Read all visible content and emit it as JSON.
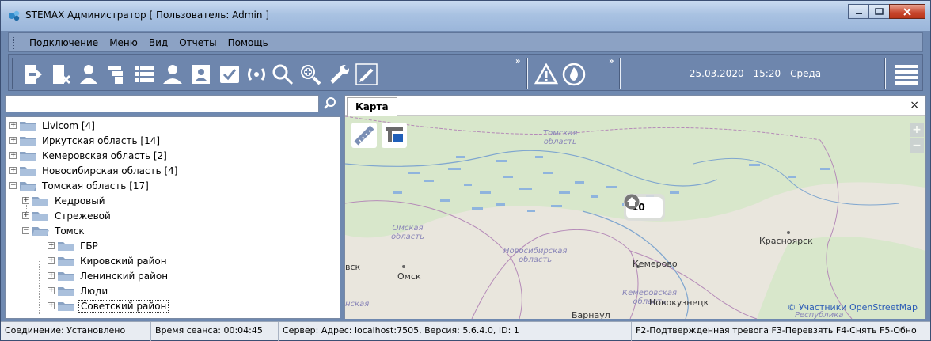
{
  "window": {
    "title": "STEMAX Администратор [ Пользователь: Admin ]"
  },
  "menu": {
    "items": [
      "Подключение",
      "Меню",
      "Вид",
      "Отчеты",
      "Помощь"
    ]
  },
  "toolbar": {
    "icons": [
      "exit-door-icon",
      "disconnect-icon",
      "user-add-icon",
      "devices-icon",
      "objects-list-icon",
      "users-icon",
      "report-icon",
      "confirm-icon",
      "signal-icon",
      "search-icon",
      "zoom-search-icon",
      "wrench-icon",
      "pencil-icon"
    ],
    "overflow_label": "»",
    "datetime": "25.03.2020 - 15:20 - Среда"
  },
  "tree": {
    "search_placeholder": "",
    "items": [
      {
        "label": "Livicom [4]",
        "level": 0,
        "expander": "+"
      },
      {
        "label": "Иркутская область [14]",
        "level": 0,
        "expander": "+"
      },
      {
        "label": "Кемеровская область [2]",
        "level": 0,
        "expander": "+"
      },
      {
        "label": "Новосибирская область [4]",
        "level": 0,
        "expander": "+"
      },
      {
        "label": "Томская область [17]",
        "level": 0,
        "expander": "−"
      },
      {
        "label": "Кедровый",
        "level": 1,
        "expander": "+"
      },
      {
        "label": "Стрежевой",
        "level": 1,
        "expander": "+"
      },
      {
        "label": "Томск",
        "level": 1,
        "expander": "−"
      },
      {
        "label": "ГБР",
        "level": 2,
        "expander": "+"
      },
      {
        "label": "Кировский район",
        "level": 2,
        "expander": "+"
      },
      {
        "label": "Ленинский район",
        "level": 2,
        "expander": "+"
      },
      {
        "label": "Люди",
        "level": 2,
        "expander": "+"
      },
      {
        "label": "Советский район",
        "level": 2,
        "expander": "+",
        "selected": true
      }
    ]
  },
  "map": {
    "tab_label": "Карта",
    "close_label": "×",
    "zoom_in": "+",
    "zoom_out": "−",
    "cluster_count": "10",
    "labels": {
      "tomsk_region": "Томская\nобласть",
      "omsk_region": "Омская\nобласть",
      "novosibirsk_region": "Новосибирская\nобласть",
      "kemerovo_region": "Кемеровская\nобласть",
      "krasnoyarsk": "Красноярск",
      "kemerovo": "Кемерово",
      "omsk": "Омск",
      "novokuznetsk": "Новокузнецк",
      "vsk": "вск",
      "barnaul": "Барнаул",
      "republic": "Республика",
      "left_edge_region": "нская"
    },
    "credit": "© Участники OpenStreetMap"
  },
  "status": {
    "connection": "Соединение: Установлено",
    "session": "Время сеанса: 00:04:45",
    "server": "Сервер: Адрес: localhost:7505, Версия: 5.6.4.0, ID: 1",
    "hotkeys": "F2-Подтвержденная тревога  F3-Перевзять  F4-Снять  F5-Обно"
  },
  "colors": {
    "toolbar_bg": "#6e86ad",
    "map_land": "#eae6dc",
    "map_forest": "#d6e6c8",
    "marsh": "#9fc0df"
  }
}
